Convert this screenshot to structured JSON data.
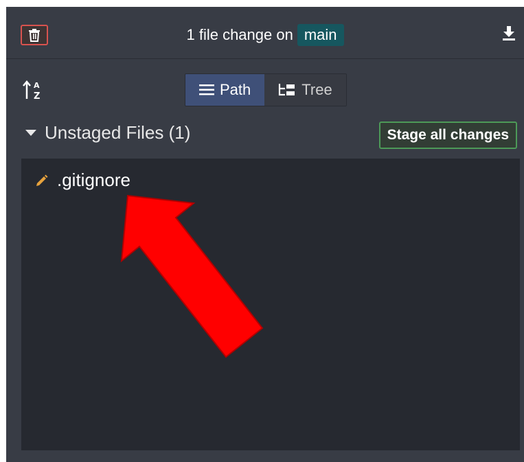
{
  "header": {
    "title_prefix": "1 file change on",
    "branch": "main",
    "trash_icon": "trash-icon",
    "download_icon": "download-icon"
  },
  "toolbar": {
    "sort_icon": "sort-alpha-icon",
    "view_modes": [
      {
        "label": "Path",
        "icon": "list-icon",
        "active": true
      },
      {
        "label": "Tree",
        "icon": "tree-icon",
        "active": false
      }
    ]
  },
  "unstaged": {
    "title": "Unstaged Files (1)",
    "stage_all_label": "Stage all changes",
    "files": [
      {
        "name": ".gitignore",
        "status_icon": "pencil-icon",
        "status_color": "#e8a33d"
      }
    ]
  },
  "annotation": {
    "type": "arrow-icon",
    "color": "#ff0000"
  },
  "colors": {
    "panel_bg": "#383c45",
    "list_bg": "#262930",
    "branch_badge": "#16575f",
    "active_toggle": "#3f5078",
    "stage_border": "#4d9a58",
    "trash_border": "#d9534f"
  }
}
